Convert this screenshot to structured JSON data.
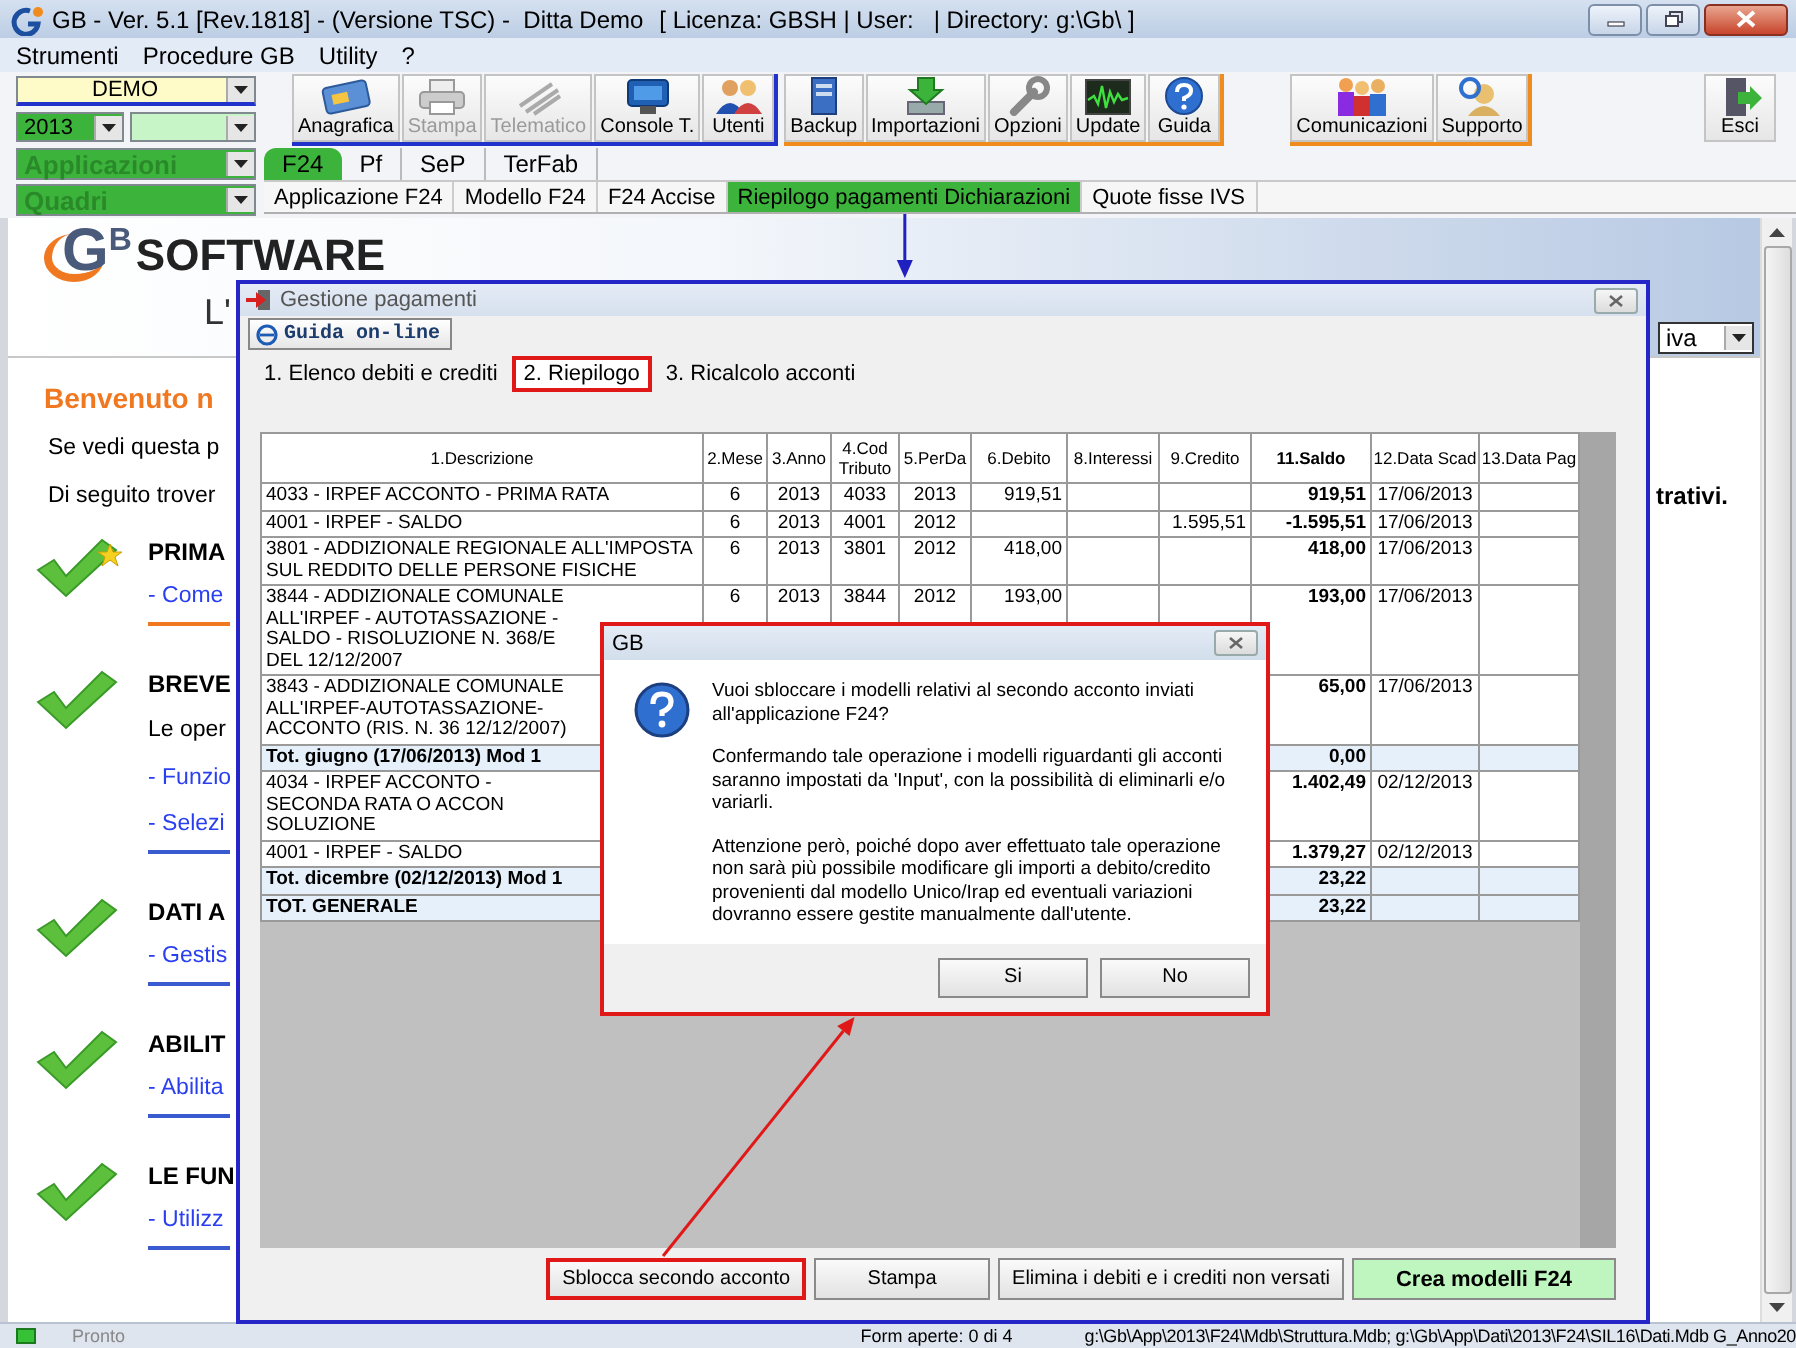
{
  "window": {
    "title": "GB - Ver. 5.1 [Rev.1818] - (Versione TSC) -  Ditta Demo",
    "license": "[ Licenza: GBSH | User:",
    "directory": "| Directory: g:\\Gb\\ ]"
  },
  "menu": [
    {
      "label": "Strumenti"
    },
    {
      "label": "Procedure GB"
    },
    {
      "label": "Utility"
    },
    {
      "label": "?"
    }
  ],
  "selectors": [
    {
      "kind": "company",
      "value": "DEMO"
    },
    {
      "kind": "year",
      "value": "2013"
    },
    {
      "kind": "blank"
    },
    {
      "kind": "section",
      "value": "Applicazioni",
      "disabled": true
    },
    {
      "kind": "section",
      "value": "Quadri",
      "disabled": true
    }
  ],
  "toolbar": [
    {
      "color": "#2233cc",
      "buttons": [
        {
          "label": "Anagrafica",
          "disabled": false
        },
        {
          "label": "Stampa",
          "disabled": true
        },
        {
          "label": "Telematico",
          "disabled": true
        },
        {
          "label": "Console T.",
          "disabled": false
        },
        {
          "label": "Utenti",
          "disabled": false
        }
      ]
    },
    {
      "color": "#f08c1e",
      "buttons": [
        {
          "label": "Backup",
          "disabled": false
        },
        {
          "label": "Importazioni",
          "disabled": false
        },
        {
          "label": "Opzioni",
          "disabled": false
        },
        {
          "label": "Update",
          "disabled": false
        },
        {
          "label": "Guida",
          "disabled": false
        }
      ]
    },
    {
      "color": "#f08c1e",
      "buttons": [
        {
          "label": "Comunicazioni",
          "disabled": false
        },
        {
          "label": "Supporto",
          "disabled": false
        }
      ]
    }
  ],
  "exit_button": {
    "label": "Esci"
  },
  "module_tabs": [
    {
      "label": "F24",
      "selected": true
    },
    {
      "label": "Pf",
      "selected": false
    },
    {
      "label": "SeP",
      "selected": false
    },
    {
      "label": "TerFab",
      "selected": false
    }
  ],
  "sub_tabs": [
    {
      "label": "Applicazione F24",
      "selected": false
    },
    {
      "label": "Modello F24",
      "selected": false
    },
    {
      "label": "F24 Accise",
      "selected": false
    },
    {
      "label": "Riepilogo pagamenti Dichiarazioni",
      "selected": true
    },
    {
      "label": "Quote fisse IVS",
      "selected": false
    }
  ],
  "page": {
    "logo": {
      "mark": "G",
      "mark_sup": "B",
      "word": "SOFTWARE",
      "tagline": "L'"
    },
    "dropdown": {
      "value": "iva"
    },
    "heading": "Benvenuto n",
    "intro": [
      {
        "text": "Se vedi questa p"
      },
      {
        "text": "Di seguito trover",
        "tail": "trativi."
      }
    ],
    "sections": [
      {
        "title": "PRIMA",
        "starred": true,
        "color": "#f07820",
        "links": [
          "- Come"
        ]
      },
      {
        "title": "BREVE",
        "starred": false,
        "text": "Le oper",
        "color": "#3a5bd0",
        "links": [
          "- Funzio",
          "- Selezi"
        ]
      },
      {
        "title": "DATI A",
        "starred": false,
        "color": "#3a5bd0",
        "links": [
          "- Gestis"
        ]
      },
      {
        "title": "ABILIT",
        "starred": false,
        "color": "#3a5bd0",
        "links": [
          "- Abilita"
        ]
      },
      {
        "title": "LE FUN",
        "starred": false,
        "color": "#3a5bd0",
        "links": [
          "- Utilizz"
        ]
      }
    ]
  },
  "dialog": {
    "title": "Gestione pagamenti",
    "help_button": "Guida on-line",
    "tabs": [
      {
        "label": "1. Elenco debiti e crediti",
        "selected": false,
        "highlighted": false
      },
      {
        "label": "2. Riepilogo",
        "selected": true,
        "highlighted": true
      },
      {
        "label": "3. Ricalcolo acconti",
        "selected": false,
        "highlighted": false
      }
    ],
    "table": {
      "columns": [
        {
          "label": "1.Descrizione",
          "emphasis": false
        },
        {
          "label": "2.Mese",
          "emphasis": false
        },
        {
          "label": "3.Anno",
          "emphasis": false
        },
        {
          "label": "4.Cod Tributo",
          "emphasis": false
        },
        {
          "label": "5.PerDa",
          "emphasis": false
        },
        {
          "label": "6.Debito",
          "emphasis": false
        },
        {
          "label": "8.Interessi",
          "emphasis": false
        },
        {
          "label": "9.Credito",
          "emphasis": false
        },
        {
          "label": "11.Saldo",
          "emphasis": true
        },
        {
          "label": "12.Data Scad",
          "emphasis": false
        },
        {
          "label": "13.Data Pag",
          "emphasis": false
        }
      ],
      "rows": [
        {
          "kind": "item",
          "cells": [
            "4033 - IRPEF ACCONTO - PRIMA RATA",
            "6",
            "2013",
            "4033",
            "2013",
            "919,51",
            null,
            null,
            "919,51",
            "17/06/2013",
            null
          ]
        },
        {
          "kind": "item",
          "cells": [
            "4001 - IRPEF - SALDO",
            "6",
            "2013",
            "4001",
            "2012",
            null,
            null,
            "1.595,51",
            "-1.595,51",
            "17/06/2013",
            null
          ]
        },
        {
          "kind": "item",
          "cells": [
            "3801 - ADDIZIONALE REGIONALE ALL'IMPOSTA SUL REDDITO DELLE PERSONE FISICHE",
            "6",
            "2013",
            "3801",
            "2012",
            "418,00",
            null,
            null,
            "418,00",
            "17/06/2013",
            null
          ]
        },
        {
          "kind": "item",
          "cells": [
            "3844 - ADDIZIONALE COMUNALE ALL'IRPEF - AUTOTASSAZIONE - SALDO - RISOLUZIONE N. 368/E DEL 12/12/2007",
            "6",
            "2013",
            "3844",
            "2012",
            "193,00",
            null,
            null,
            "193,00",
            "17/06/2013",
            null
          ]
        },
        {
          "kind": "item",
          "cells": [
            "3843 - ADDIZIONALE COMUNALE ALL'IRPEF-AUTOTASSAZIONE-ACCONTO (RIS. N. 36 12/12/2007)",
            null,
            null,
            null,
            null,
            null,
            null,
            null,
            "65,00",
            "17/06/2013",
            null
          ]
        },
        {
          "kind": "total",
          "cells": [
            "Tot. giugno (17/06/2013) Mod 1",
            null,
            null,
            null,
            null,
            null,
            null,
            null,
            "0,00",
            null,
            null
          ]
        },
        {
          "kind": "item",
          "cells": [
            "4034 - IRPEF ACCONTO - SECONDA RATA O ACCON SOLUZIONE",
            null,
            null,
            null,
            null,
            null,
            null,
            null,
            "1.402,49",
            "02/12/2013",
            null
          ]
        },
        {
          "kind": "item",
          "cells": [
            "4001 - IRPEF - SALDO",
            null,
            null,
            null,
            null,
            null,
            null,
            null,
            "1.379,27",
            "02/12/2013",
            null
          ]
        },
        {
          "kind": "total",
          "cells": [
            "Tot. dicembre (02/12/2013) Mod 1",
            null,
            null,
            null,
            null,
            null,
            null,
            null,
            "23,22",
            null,
            null
          ]
        },
        {
          "kind": "total",
          "cells": [
            "TOT. GENERALE",
            null,
            null,
            null,
            null,
            null,
            null,
            null,
            "23,22",
            null,
            null
          ]
        }
      ]
    },
    "buttons": [
      {
        "label": "Sblocca secondo acconto",
        "kind": "normal",
        "highlighted": true
      },
      {
        "label": "Stampa",
        "kind": "normal",
        "highlighted": false
      },
      {
        "label": "Elimina i debiti e i crediti non versati",
        "kind": "normal",
        "highlighted": false
      },
      {
        "label": "Crea modelli F24",
        "kind": "primary",
        "highlighted": false
      }
    ]
  },
  "modal": {
    "title": "GB",
    "highlighted": true,
    "paragraphs": [
      "Vuoi sbloccare i modelli relativi al secondo acconto inviati all'applicazione F24?",
      "Confermando tale operazione i modelli riguardanti gli acconti saranno impostati da 'Input', con la possibilità di eliminarli e/o variarli.",
      "Attenzione però, poiché dopo aver effettuato tale operazione non sarà più possibile modificare gli importi a debito/credito provenienti dal modello Unico/Irap ed eventuali variazioni dovranno essere gestite manualmente dall'utente."
    ],
    "buttons": [
      {
        "label": "Si"
      },
      {
        "label": "No"
      }
    ]
  },
  "status_bar": {
    "text": "Pronto",
    "forms": "Form aperte: 0 di 4",
    "path": "g:\\Gb\\App\\2013\\F24\\Mdb\\Struttura.Mdb; g:\\Gb\\App\\Dati\\2013\\F24\\SIL16\\Dati.Mdb G_Anno20"
  }
}
